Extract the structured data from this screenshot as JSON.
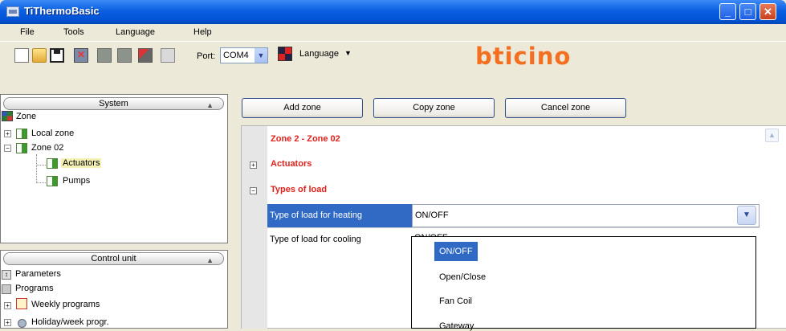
{
  "window": {
    "title": "TiThermoBasic"
  },
  "menu": [
    "File",
    "Tools",
    "Language",
    "Help"
  ],
  "toolbar": {
    "port_label": "Port:",
    "port_value": "COM4",
    "language_label": "Language",
    "brand": "bticino"
  },
  "system_pane": {
    "header": "System",
    "tree": {
      "root": "Zone",
      "local_zone": "Local zone",
      "zone02": "Zone 02",
      "actuators": "Actuators",
      "pumps": "Pumps"
    }
  },
  "control_pane": {
    "header": "Control unit",
    "items": [
      "Parameters",
      "Programs",
      "Weekly programs",
      "Holiday/week progr."
    ]
  },
  "actions": {
    "add": "Add zone",
    "copy": "Copy zone",
    "cancel": "Cancel zone"
  },
  "grid": {
    "zone_title": "Zone 2 - Zone 02",
    "sections": [
      "Actuators",
      "Types of load"
    ],
    "rows": [
      {
        "label": "Type of load for heating",
        "value": "ON/OFF"
      },
      {
        "label": "Type of load for cooling",
        "value": "ON/OFF"
      }
    ],
    "dropdown_options": [
      "ON/OFF",
      "Open/Close",
      "Fan Coil",
      "Gateway"
    ]
  },
  "colors": {
    "titlebar": "#0a5fe0",
    "selection": "#316ac5",
    "section_red": "#e0201b",
    "brand": "#f46f1f"
  }
}
